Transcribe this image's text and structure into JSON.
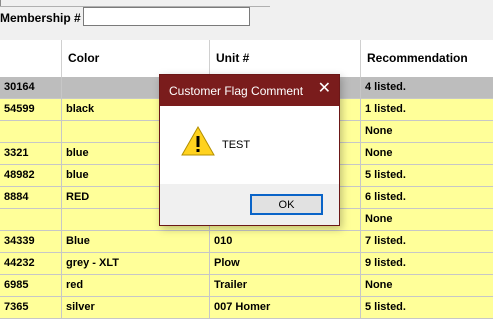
{
  "form": {
    "membership_label": "Membership #",
    "membership_value": ""
  },
  "grid": {
    "columns": [
      "",
      "Color",
      "Unit #",
      "Recommendation"
    ],
    "rows": [
      {
        "id": "30164",
        "color": "",
        "unit": "",
        "recommendation": "4 listed.",
        "style": "first"
      },
      {
        "id": "54599",
        "color": "black",
        "unit": "",
        "recommendation": "1 listed.",
        "style": "yellow"
      },
      {
        "id": "",
        "color": "",
        "unit": "",
        "recommendation": "None",
        "style": "yellow"
      },
      {
        "id": "3321",
        "color": "blue",
        "unit": "",
        "recommendation": "None",
        "style": "yellow"
      },
      {
        "id": "48982",
        "color": "blue",
        "unit": "",
        "recommendation": "5 listed.",
        "style": "yellow"
      },
      {
        "id": "8884",
        "color": "RED",
        "unit": "",
        "recommendation": "6 listed.",
        "style": "yellow"
      },
      {
        "id": "",
        "color": "",
        "unit": "",
        "recommendation": "None",
        "style": "yellow"
      },
      {
        "id": "34339",
        "color": "Blue",
        "unit": "010",
        "recommendation": "7 listed.",
        "style": "yellow"
      },
      {
        "id": "44232",
        "color": "grey - XLT",
        "unit": "Plow",
        "recommendation": "9 listed.",
        "style": "yellow"
      },
      {
        "id": "6985",
        "color": "red",
        "unit": "Trailer",
        "recommendation": "None",
        "style": "yellow"
      },
      {
        "id": "7365",
        "color": "silver",
        "unit": "007 Homer",
        "recommendation": "5 listed.",
        "style": "yellow"
      }
    ]
  },
  "dialog": {
    "title": "Customer Flag Comment",
    "close_glyph": "✕",
    "icon": "warning-icon",
    "message": "TEST",
    "ok_label": "OK"
  },
  "colors": {
    "title_bar": "#7a1c1c",
    "row_yellow": "#ffff99",
    "row_selected": "#bdbdbd",
    "ok_focus": "#0a64c8"
  }
}
